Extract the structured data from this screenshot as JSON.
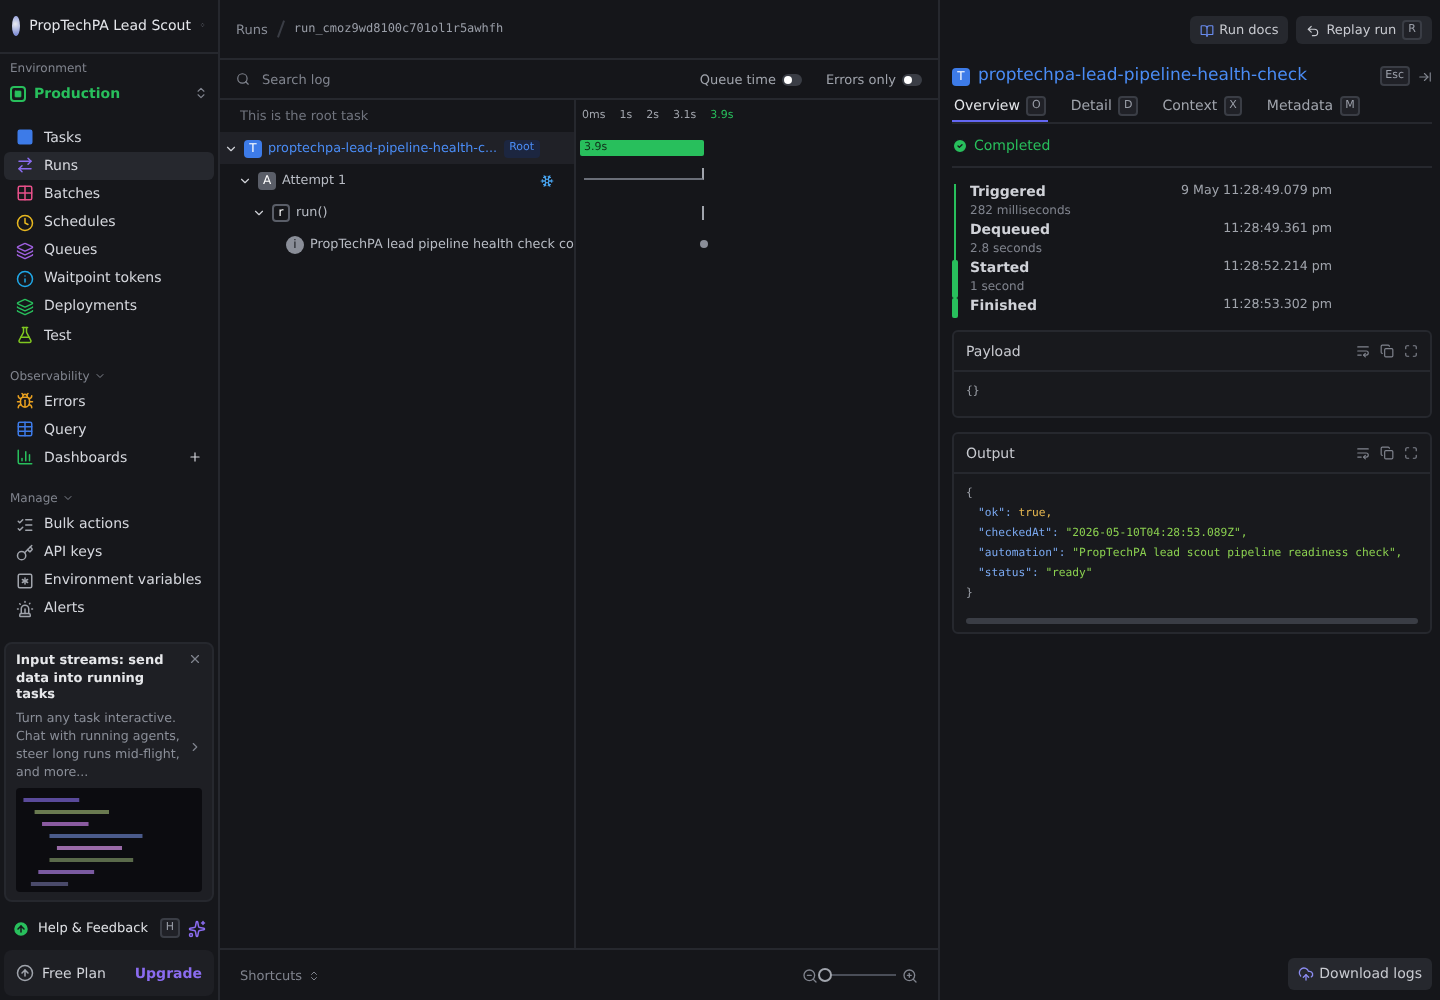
{
  "project": {
    "name": "PropTechPA Lead Scout"
  },
  "environment": {
    "label": "Environment",
    "name": "Production"
  },
  "sidebar": {
    "sections": [
      {
        "items": [
          {
            "label": "Tasks",
            "selected": false
          },
          {
            "label": "Runs",
            "selected": true
          },
          {
            "label": "Batches",
            "selected": false
          },
          {
            "label": "Schedules",
            "selected": false
          },
          {
            "label": "Queues",
            "selected": false
          },
          {
            "label": "Waitpoint tokens",
            "selected": false
          },
          {
            "label": "Deployments",
            "selected": false
          },
          {
            "label": "Test",
            "selected": false
          }
        ]
      },
      {
        "title": "Observability",
        "items": [
          {
            "label": "Errors",
            "selected": false
          },
          {
            "label": "Query",
            "selected": false
          },
          {
            "label": "Dashboards",
            "selected": false
          }
        ]
      },
      {
        "title": "Manage",
        "items": [
          {
            "label": "Bulk actions",
            "selected": false
          },
          {
            "label": "API keys",
            "selected": false
          },
          {
            "label": "Environment variables",
            "selected": false
          },
          {
            "label": "Alerts",
            "selected": false
          }
        ]
      }
    ],
    "promo": {
      "title": "Input streams: send data into running tasks",
      "body": "Turn any task interactive. Chat with running agents, steer long runs mid-flight, and more..."
    },
    "help": {
      "label": "Help & Feedback",
      "shortcut": "H"
    },
    "plan": {
      "label": "Free Plan",
      "action": "Upgrade"
    }
  },
  "breadcrumb": [
    "Runs",
    "run_cmoz9wd8100c701ol1r5awhfh"
  ],
  "search": {
    "placeholder": "Search log"
  },
  "toggles": [
    {
      "label": "Queue time",
      "on": false
    },
    {
      "label": "Errors only",
      "on": false
    }
  ],
  "tree": {
    "caption": "This is the root task",
    "rows": [
      {
        "badge": "T",
        "label": "proptechpa-lead-pipeline-health-c...",
        "tag": "Root",
        "expanded": true,
        "selected": true,
        "children": [
          {
            "badge": "A",
            "label": "Attempt 1",
            "expanded": true,
            "selected": false,
            "children": [
              {
                "badge": "r",
                "label": "run()",
                "expanded": true,
                "selected": false,
                "children": [
                  {
                    "badge": "i",
                    "label": "PropTechPA lead pipeline health check co",
                    "selected": false
                  }
                ]
              }
            ]
          }
        ]
      }
    ]
  },
  "timeline": {
    "ticks": [
      "0ms",
      "1s",
      "2s",
      "3.1s",
      "3.9s"
    ],
    "bar_label": "3.9s"
  },
  "bottom": {
    "shortcuts": "Shortcuts",
    "zoom": {
      "level": 0.0
    },
    "download": "Download logs"
  },
  "actions": [
    {
      "label": "Run docs"
    },
    {
      "label": "Replay run",
      "shortcut": "R"
    }
  ],
  "detail": {
    "badge": "T",
    "title": "proptechpa-lead-pipeline-health-check",
    "close_shortcut": "Esc",
    "tabs": [
      {
        "label": "Overview",
        "shortcut": "O",
        "selected": true
      },
      {
        "label": "Detail",
        "shortcut": "D",
        "selected": false
      },
      {
        "label": "Context",
        "shortcut": "X",
        "selected": false
      },
      {
        "label": "Metadata",
        "shortcut": "M",
        "selected": false
      }
    ],
    "status": "Completed",
    "events": [
      {
        "label": "Triggered",
        "time": "9 May 11:28:49.079 pm",
        "gap": "282 milliseconds"
      },
      {
        "label": "Dequeued",
        "time": "11:28:49.361 pm",
        "gap": "2.8 seconds"
      },
      {
        "label": "Started",
        "time": "11:28:52.214 pm",
        "gap": "1 second"
      },
      {
        "label": "Finished",
        "time": "11:28:53.302 pm"
      }
    ],
    "payload": {
      "title": "Payload",
      "lines": [
        {
          "kind": "brace",
          "text": "{}"
        }
      ]
    },
    "output": {
      "title": "Output",
      "lines": [
        {
          "kind": "brace",
          "text": "{"
        },
        {
          "kind": "bool",
          "key": "\"ok\":",
          "value": "true,"
        },
        {
          "kind": "string",
          "key": "\"checkedAt\":",
          "value": "\"2026-05-10T04:28:53.089Z\","
        },
        {
          "kind": "string",
          "key": "\"automation\":",
          "value": "\"PropTechPA lead scout pipeline readiness check\","
        },
        {
          "kind": "string",
          "key": "\"status\":",
          "value": "\"ready\""
        },
        {
          "kind": "brace",
          "text": "}"
        }
      ]
    }
  }
}
